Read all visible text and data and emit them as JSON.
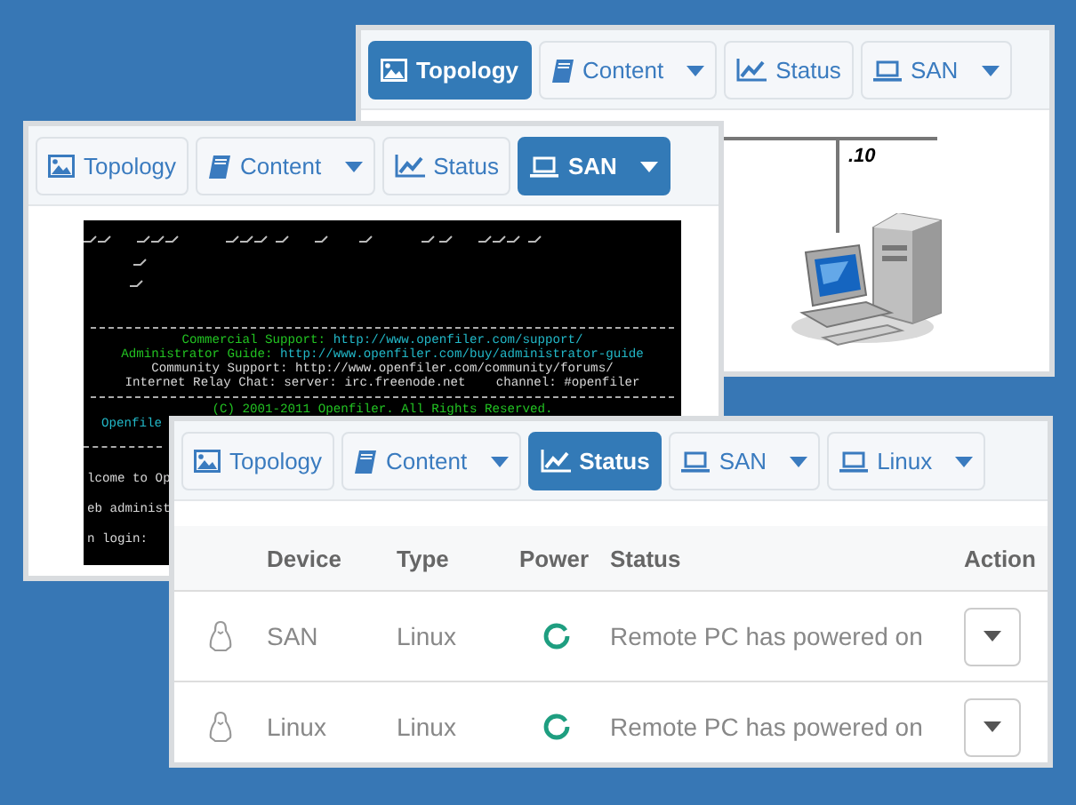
{
  "windows": [
    {
      "tabs": [
        {
          "label": "Topology",
          "kind": "image",
          "dropdown": false,
          "selected": true
        },
        {
          "label": "Content",
          "kind": "book",
          "dropdown": true,
          "selected": false
        },
        {
          "label": "Status",
          "kind": "chart",
          "dropdown": false,
          "selected": false
        },
        {
          "label": "SAN",
          "kind": "laptop",
          "dropdown": true,
          "selected": false
        }
      ],
      "topology": {
        "address": ".10"
      }
    },
    {
      "tabs": [
        {
          "label": "Topology",
          "kind": "image",
          "dropdown": false,
          "selected": false
        },
        {
          "label": "Content",
          "kind": "book",
          "dropdown": true,
          "selected": false
        },
        {
          "label": "Status",
          "kind": "chart",
          "dropdown": false,
          "selected": false
        },
        {
          "label": "SAN",
          "kind": "laptop",
          "dropdown": true,
          "selected": true
        }
      ],
      "console": {
        "lines": [
          {
            "kind": "text",
            "segments": [
              {
                "text": "Commercial Support: ",
                "color": "#22c322"
              },
              {
                "text": "http://www.openfiler.com/support/",
                "color": "#22b8c8"
              }
            ]
          },
          {
            "kind": "text",
            "segments": [
              {
                "text": "Administrator Guide: ",
                "color": "#22c322"
              },
              {
                "text": "http://www.openfiler.com/buy/administrator-guide",
                "color": "#22b8c8"
              }
            ]
          },
          {
            "kind": "text",
            "segments": [
              {
                "text": "Community Support: http://www.openfiler.com/community/forums/",
                "color": "#d8d8d8"
              }
            ]
          },
          {
            "kind": "text",
            "segments": [
              {
                "text": "Internet Relay Chat: server: irc.freenode.net    channel: #openfiler",
                "color": "#d8d8d8"
              }
            ]
          },
          {
            "kind": "rule"
          },
          {
            "kind": "text",
            "segments": [
              {
                "text": "(C) 2001-2011 Openfiler. All Rights Reserved.",
                "color": "#22c322"
              }
            ]
          }
        ],
        "cut_lines": [
          {
            "kind": "text",
            "segments": [
              {
                "text": "Openfile",
                "color": "#22b8c8"
              }
            ]
          },
          {
            "kind": "rule"
          },
          {
            "kind": "text",
            "segments": [
              {
                "text": "lcome to Op",
                "color": "#d8d8d8"
              }
            ]
          },
          {
            "kind": "text",
            "segments": [
              {
                "text": "eb administ",
                "color": "#d8d8d8"
              }
            ]
          },
          {
            "kind": "text",
            "segments": [
              {
                "text": "n login:",
                "color": "#d8d8d8"
              }
            ]
          }
        ]
      }
    },
    {
      "tabs": [
        {
          "label": "Topology",
          "kind": "image",
          "dropdown": false,
          "selected": false
        },
        {
          "label": "Content",
          "kind": "book",
          "dropdown": true,
          "selected": false
        },
        {
          "label": "Status",
          "kind": "chart",
          "dropdown": false,
          "selected": true
        },
        {
          "label": "SAN",
          "kind": "laptop",
          "dropdown": true,
          "selected": false
        },
        {
          "label": "Linux",
          "kind": "laptop",
          "dropdown": true,
          "selected": false
        }
      ],
      "table": {
        "columns": [
          "Device",
          "Type",
          "Power",
          "Status",
          "Action"
        ],
        "rows": [
          {
            "device": "SAN",
            "type": "Linux",
            "status": "Remote PC has powered on"
          },
          {
            "device": "Linux",
            "type": "Linux",
            "status": "Remote PC has powered on"
          }
        ]
      }
    }
  ]
}
